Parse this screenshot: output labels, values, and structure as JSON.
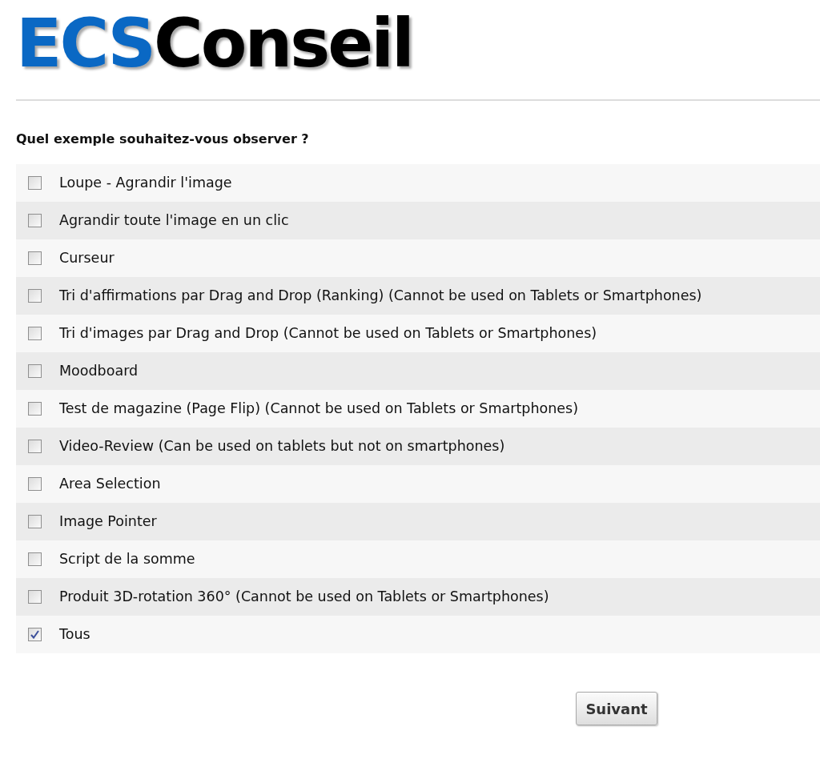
{
  "logo": {
    "accent": "ECS",
    "name": "Conseil"
  },
  "question": "Quel exemple souhaitez-vous observer ?",
  "options": [
    {
      "label": "Loupe - Agrandir l'image",
      "checked": false
    },
    {
      "label": "Agrandir toute l'image en un clic",
      "checked": false
    },
    {
      "label": "Curseur",
      "checked": false
    },
    {
      "label": "Tri d'affirmations par Drag and Drop (Ranking) (Cannot be used on Tablets or Smartphones)",
      "checked": false
    },
    {
      "label": "Tri d'images par Drag and Drop (Cannot be used on Tablets or Smartphones)",
      "checked": false
    },
    {
      "label": "Moodboard",
      "checked": false
    },
    {
      "label": "Test de magazine (Page Flip) (Cannot be used on Tablets or Smartphones)",
      "checked": false
    },
    {
      "label": "Video-Review (Can be used on tablets but not on smartphones)",
      "checked": false
    },
    {
      "label": "Area Selection",
      "checked": false
    },
    {
      "label": "Image Pointer",
      "checked": false
    },
    {
      "label": "Script de la somme",
      "checked": false
    },
    {
      "label": "Produit 3D-rotation 360° (Cannot be used on Tablets or Smartphones)",
      "checked": false
    },
    {
      "label": "Tous",
      "checked": true
    }
  ],
  "next_button": "Suivant"
}
